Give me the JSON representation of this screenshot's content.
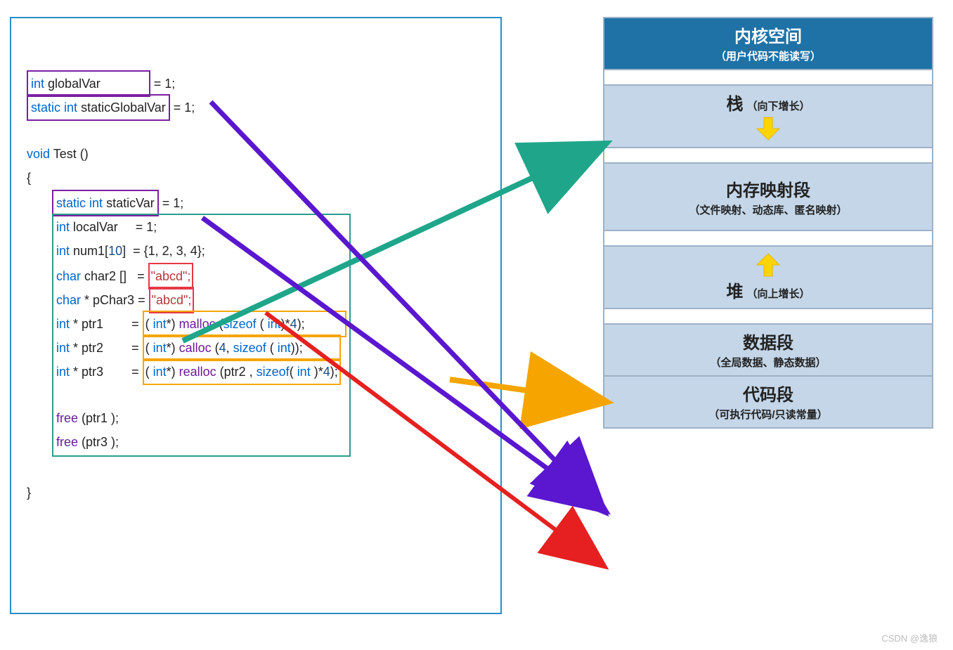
{
  "watermark": "CSDN @逸狼",
  "code": {
    "global_var_decl": "int globalVar",
    "global_var_init": " = 1;",
    "static_global_decl": "static int staticGlobalVar",
    "static_global_init": " = 1;",
    "test_sig": "void Test ()",
    "brace_open": "{",
    "brace_close": "}",
    "static_var_decl": "static int staticVar",
    "static_var_init": " = 1;",
    "local_var": "int localVar",
    "local_var_init": "= 1;",
    "num1": "int num1[10]",
    "num1_init": "= {1, 2, 3, 4};",
    "char2": "char char2 []",
    "char2_eq": "= ",
    "abcd1": "\"abcd\";",
    "pchar3": "char * pChar3",
    "pchar3_eq": "= ",
    "abcd2": "\"abcd\";",
    "ptr1": "int * ptr1",
    "ptr1_eq": "= ",
    "ptr1_rhs": "( int*) malloc (sizeof ( int)*4);",
    "ptr2": "int * ptr2",
    "ptr2_eq": "= ",
    "ptr2_rhs": "( int*) calloc (4, sizeof ( int));",
    "ptr3": "int * ptr3",
    "ptr3_eq": "= ",
    "ptr3_rhs": "( int*) realloc (ptr2 , sizeof( int )*4);",
    "free1": "free (ptr1 );",
    "free3": "free (ptr3 );"
  },
  "mem": {
    "kernel_title": "内核空间",
    "kernel_sub": "（用户代码不能读写）",
    "stack_title": "栈",
    "stack_note": "（向下增长）",
    "mmap_title": "内存映射段",
    "mmap_sub": "（文件映射、动态库、匿名映射）",
    "heap_title": "堆",
    "heap_note": "（向上增长）",
    "data_title": "数据段",
    "data_sub": "（全局数据、静态数据）",
    "code_title": "代码段",
    "code_sub": "（可执行代码/只读常量）"
  },
  "colors": {
    "arrow_teal": "#1fa68a",
    "arrow_orange": "#f6a500",
    "arrow_purple": "#5a17cf",
    "arrow_red": "#e62020"
  }
}
